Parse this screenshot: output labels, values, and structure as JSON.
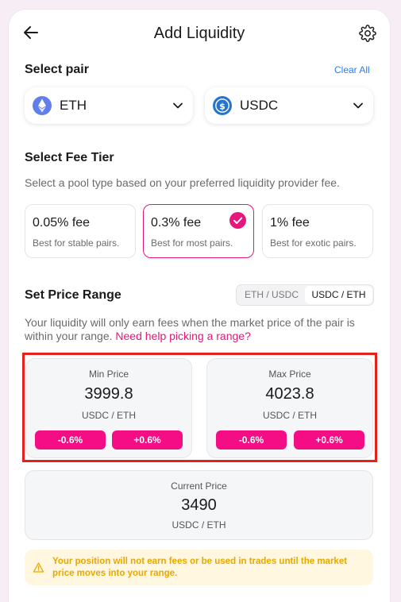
{
  "header": {
    "title": "Add Liquidity"
  },
  "pair": {
    "title": "Select pair",
    "clear_label": "Clear All",
    "token_a": {
      "symbol": "ETH",
      "icon": "eth-icon"
    },
    "token_b": {
      "symbol": "USDC",
      "icon": "usdc-icon"
    }
  },
  "fee": {
    "title": "Select Fee Tier",
    "description": "Select a pool type based on your preferred liquidity provider fee.",
    "tiers": [
      {
        "name": "0.05% fee",
        "desc": "Best for stable pairs.",
        "selected": false
      },
      {
        "name": "0.3% fee",
        "desc": "Best for most pairs.",
        "selected": true
      },
      {
        "name": "1% fee",
        "desc": "Best for exotic pairs.",
        "selected": false
      }
    ]
  },
  "range": {
    "title": "Set Price Range",
    "toggle": {
      "option_a": "ETH / USDC",
      "option_b": "USDC / ETH",
      "selected": "USDC / ETH"
    },
    "description": "Your liquidity will only earn fees when the market price of the pair is within your range.",
    "help_link": "Need help picking a range?",
    "min": {
      "label": "Min Price",
      "value": "3999.8",
      "unit": "USDC / ETH",
      "dec_label": "-0.6%",
      "inc_label": "+0.6%"
    },
    "max": {
      "label": "Max Price",
      "value": "4023.8",
      "unit": "USDC / ETH",
      "dec_label": "-0.6%",
      "inc_label": "+0.6%"
    },
    "current": {
      "label": "Current Price",
      "value": "3490",
      "unit": "USDC / ETH"
    }
  },
  "warning": {
    "text": "Your position will not earn fees or be used in trades until the market price moves into your range."
  },
  "colors": {
    "accent": "#e8157a",
    "button": "#f40d84",
    "link": "#2b7de9",
    "highlight": "#e4221b",
    "warning_text": "#e9a800",
    "warning_bg": "#fff7e0",
    "eth_bg": "#627eea",
    "usdc_bg": "#2775ca"
  }
}
